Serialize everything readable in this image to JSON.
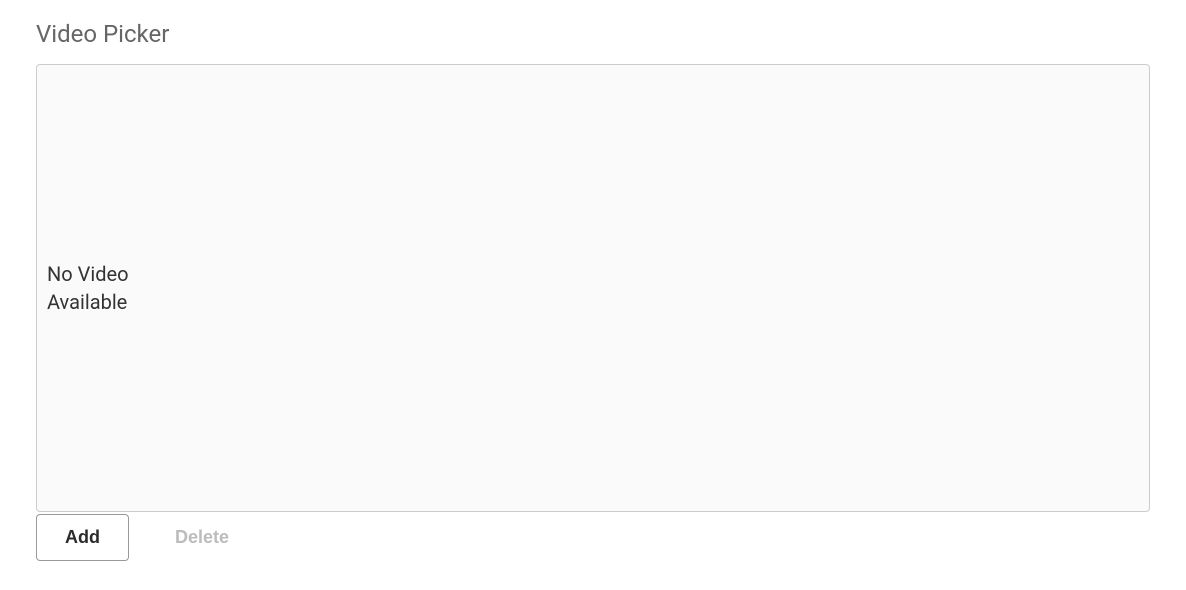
{
  "section": {
    "title": "Video Picker"
  },
  "preview": {
    "empty_message": "No Video Available"
  },
  "buttons": {
    "add": "Add",
    "delete": "Delete"
  }
}
